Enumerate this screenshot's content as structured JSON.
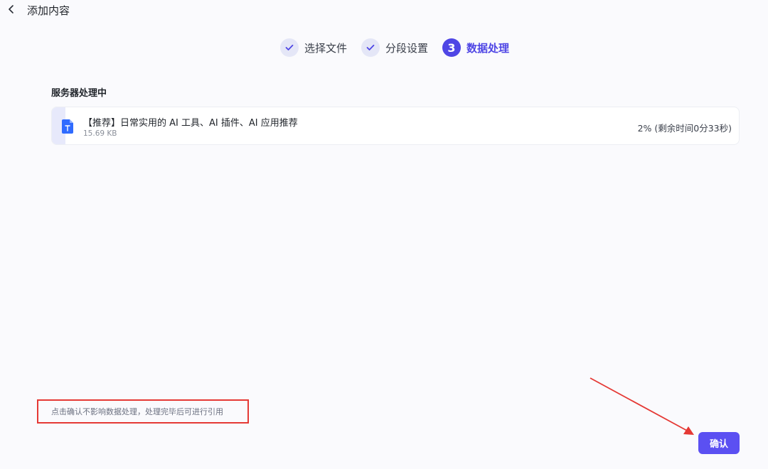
{
  "header": {
    "title": "添加内容"
  },
  "steps": [
    {
      "label": "选择文件",
      "status": "done"
    },
    {
      "label": "分段设置",
      "status": "done"
    },
    {
      "label": "数据处理",
      "number": "3",
      "status": "active"
    }
  ],
  "section": {
    "title": "服务器处理中"
  },
  "file": {
    "name": "【推荐】日常实用的 AI 工具、AI 插件、AI 应用推荐",
    "size": "15.69 KB",
    "status": "2% (剩余时间0分33秒)",
    "progress": 0.02
  },
  "note": {
    "text": "点击确认不影响数据处理，处理完毕后可进行引用"
  },
  "actions": {
    "confirm_label": "确认"
  },
  "colors": {
    "accent": "#4f46e5",
    "button": "#5b50f2",
    "highlight_red": "#e53935",
    "file_icon": "#2f6bff"
  }
}
